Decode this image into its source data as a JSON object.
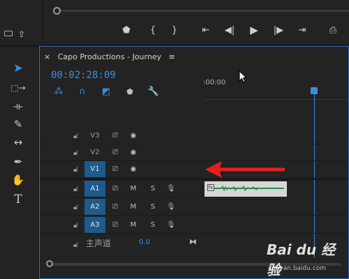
{
  "panel": {
    "title": "Capo Productions - Journey",
    "close_glyph": "×",
    "menu_glyph": "≡"
  },
  "timecode": "00:02:28:09",
  "ruler": {
    "time_label": ":00:00"
  },
  "video_tracks": [
    {
      "name": "V3",
      "selected": false
    },
    {
      "name": "V2",
      "selected": false
    },
    {
      "name": "V1",
      "selected": true
    }
  ],
  "audio_tracks": [
    {
      "name": "A1",
      "selected": true,
      "m": "M",
      "s": "S"
    },
    {
      "name": "A2",
      "selected": true,
      "m": "M",
      "s": "S"
    },
    {
      "name": "A3",
      "selected": true,
      "m": "M",
      "s": "S"
    }
  ],
  "master": {
    "label": "主声道",
    "value": "0.0"
  },
  "watermark": {
    "main": "Bai du 经验",
    "sub": "jingyan.baidu.com"
  },
  "colors": {
    "accent": "#3e8ddd",
    "track_selected": "#1e5a8c",
    "annotation_arrow": "#e32020"
  }
}
